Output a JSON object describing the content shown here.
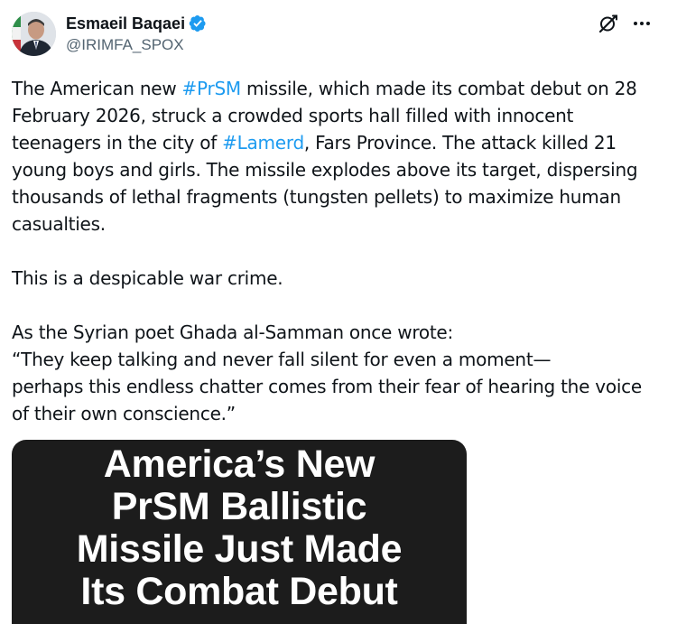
{
  "author": {
    "display_name": "Esmaeil Baqaei",
    "handle": "@IRIMFA_SPOX",
    "verified": true,
    "avatar_icon": "avatar"
  },
  "actions": {
    "grok_icon": "grok-icon",
    "more_icon": "more-icon"
  },
  "tweet": {
    "p1_a": "The American new ",
    "p1_tag1": "#PrSM",
    "p1_b": " missile, which made its combat debut on 28 February 2026, struck a crowded sports hall filled with innocent teenagers in the city of ",
    "p1_tag2": "#Lamerd",
    "p1_c": ", Fars Province. The attack killed 21 young boys and girls. The missile explodes above its target, dispersing thousands of lethal fragments (tungsten pellets) to maximize human casualties.",
    "p2": "This is a despicable war crime.",
    "p3_l1": "As the Syrian poet Ghada al-Samman once wrote:",
    "p3_l2": "“They keep talking and never fall silent for even a moment—",
    "p3_l3": "perhaps this endless chatter comes from their fear of hearing the voice of their own conscience.”"
  },
  "media": {
    "title_lines": [
      "America’s New",
      "PrSM Ballistic",
      "Missile Just Made",
      "Its Combat Debut"
    ]
  },
  "colors": {
    "link": "#1d9bf0",
    "secondary_text": "#536471",
    "verified_badge": "#1d9bf0",
    "media_bg": "#1c1c1c"
  }
}
